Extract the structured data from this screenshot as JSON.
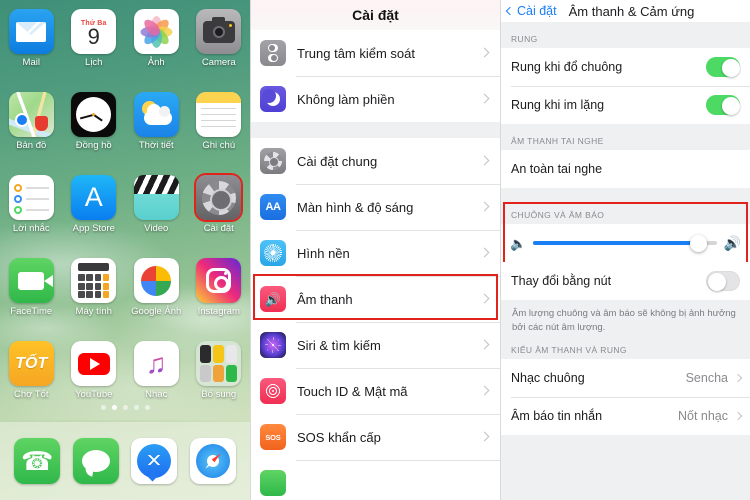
{
  "home": {
    "apps": [
      {
        "label": "Mail",
        "icon": "mail-icon"
      },
      {
        "label": "Lịch",
        "icon": "calendar-icon",
        "day": "Thứ Ba",
        "date": "9"
      },
      {
        "label": "Ảnh",
        "icon": "photos-icon"
      },
      {
        "label": "Camera",
        "icon": "camera-icon"
      },
      {
        "label": "Bản đồ",
        "icon": "maps-icon"
      },
      {
        "label": "Đồng hồ",
        "icon": "clock-icon"
      },
      {
        "label": "Thời tiết",
        "icon": "weather-icon"
      },
      {
        "label": "Ghi chú",
        "icon": "notes-icon"
      },
      {
        "label": "Lời nhắc",
        "icon": "reminders-icon"
      },
      {
        "label": "App Store",
        "icon": "app-store-icon"
      },
      {
        "label": "Video",
        "icon": "video-icon"
      },
      {
        "label": "Cài đặt",
        "icon": "settings-icon"
      },
      {
        "label": "FaceTime",
        "icon": "facetime-icon"
      },
      {
        "label": "Máy tính",
        "icon": "calculator-icon"
      },
      {
        "label": "Google Ảnh",
        "icon": "google-photos-icon"
      },
      {
        "label": "Instagram",
        "icon": "instagram-icon"
      },
      {
        "label": "Chợ Tốt",
        "icon": "chotot-icon",
        "text": "TỐT"
      },
      {
        "label": "YouTube",
        "icon": "youtube-icon"
      },
      {
        "label": "Nhạc",
        "icon": "music-icon"
      },
      {
        "label": "Bổ sung",
        "icon": "folder-icon"
      }
    ],
    "page_dots": {
      "count": 5,
      "active_index": 1
    },
    "dock": [
      {
        "label": "Phone",
        "icon": "phone-icon"
      },
      {
        "label": "Messages",
        "icon": "messages-icon"
      },
      {
        "label": "Messenger",
        "icon": "messenger-icon"
      },
      {
        "label": "Safari",
        "icon": "safari-icon"
      }
    ]
  },
  "settings": {
    "title": "Cài đặt",
    "group1": [
      {
        "label": "Trung tâm kiểm soát",
        "icon": "control-center-icon"
      },
      {
        "label": "Không làm phiền",
        "icon": "do-not-disturb-icon"
      }
    ],
    "group2": [
      {
        "label": "Cài đặt chung",
        "icon": "general-icon"
      },
      {
        "label": "Màn hình & độ sáng",
        "icon": "display-brightness-icon"
      },
      {
        "label": "Hình nền",
        "icon": "wallpaper-icon"
      },
      {
        "label": "Âm thanh",
        "icon": "sounds-icon",
        "highlighted": true
      },
      {
        "label": "Siri & tìm kiếm",
        "icon": "siri-icon"
      },
      {
        "label": "Touch ID & Mật mã",
        "icon": "touch-id-icon"
      },
      {
        "label": "SOS khẩn cấp",
        "icon": "emergency-sos-icon"
      }
    ]
  },
  "sound": {
    "back_label": "Cài đặt",
    "title": "Âm thanh & Cảm ứng",
    "section_vibrate": "RUNG",
    "vibrate_rows": [
      {
        "label": "Rung khi đổ chuông",
        "toggle": "on"
      },
      {
        "label": "Rung khi im lặng",
        "toggle": "on"
      }
    ],
    "section_headphone": "ÂM THANH TAI NGHE",
    "headphone_rows": [
      {
        "label": "An toàn tai nghe"
      }
    ],
    "section_ringer": "CHUÔNG VÀ ÂM BÁO",
    "slider": {
      "value": 90,
      "left_icon": "speaker-low-icon",
      "right_icon": "speaker-high-icon"
    },
    "change_with_buttons": {
      "label": "Thay đổi bằng nút",
      "toggle": "off"
    },
    "footnote": "Âm lượng chuông và âm báo sẽ không bị ảnh hưởng bởi các nút âm lượng.",
    "section_sound_pattern": "KIỂU ÂM THANH VÀ RUNG",
    "pattern_rows": [
      {
        "label": "Nhạc chuông",
        "value": "Sencha"
      },
      {
        "label": "Âm báo tin nhắn",
        "value": "Nốt nhạc"
      }
    ]
  },
  "colors": {
    "highlight": "#e1241b",
    "accent_blue": "#1a7ef5",
    "toggle_on": "#4cd964",
    "group_bg": "#eff0f2"
  }
}
